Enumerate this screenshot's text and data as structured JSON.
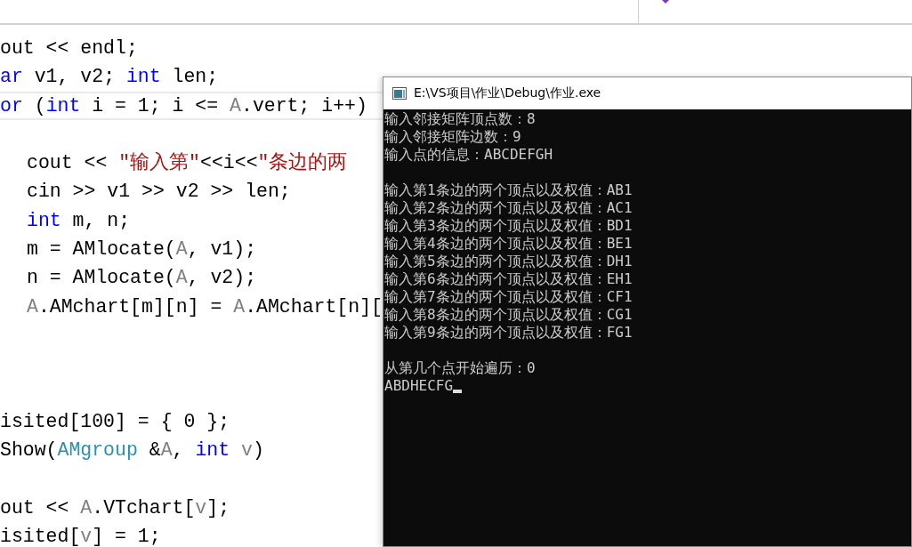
{
  "editor": {
    "lines": [
      {
        "kind": "code",
        "indented": false,
        "current": false,
        "segments": [
          {
            "kind": "plain",
            "text": "out << endl;"
          }
        ]
      },
      {
        "kind": "code",
        "indented": false,
        "current": false,
        "segments": [
          {
            "kind": "keyword",
            "text": "ar"
          },
          {
            "kind": "plain",
            "text": " v1, v2; "
          },
          {
            "kind": "keyword",
            "text": "int"
          },
          {
            "kind": "plain",
            "text": " len;"
          }
        ]
      },
      {
        "kind": "code",
        "indented": false,
        "current": true,
        "segments": [
          {
            "kind": "keyword",
            "text": "or"
          },
          {
            "kind": "plain",
            "text": " ("
          },
          {
            "kind": "keyword",
            "text": "int"
          },
          {
            "kind": "plain",
            "text": " i = 1; i <= "
          },
          {
            "kind": "param",
            "text": "A"
          },
          {
            "kind": "plain",
            "text": ".vert; i++)"
          }
        ]
      },
      {
        "kind": "blank"
      },
      {
        "kind": "code",
        "indented": true,
        "current": false,
        "segments": [
          {
            "kind": "plain",
            "text": "cout << "
          },
          {
            "kind": "string",
            "text": "\"输入第\""
          },
          {
            "kind": "plain",
            "text": "<<i<<"
          },
          {
            "kind": "string",
            "text": "\"条边的两"
          }
        ]
      },
      {
        "kind": "code",
        "indented": true,
        "current": false,
        "segments": [
          {
            "kind": "plain",
            "text": "cin >> v1 >> v2 >> len;"
          }
        ]
      },
      {
        "kind": "code",
        "indented": true,
        "current": false,
        "segments": [
          {
            "kind": "keyword",
            "text": "int"
          },
          {
            "kind": "plain",
            "text": " m, n;"
          }
        ]
      },
      {
        "kind": "code",
        "indented": true,
        "current": false,
        "segments": [
          {
            "kind": "plain",
            "text": "m = AMlocate("
          },
          {
            "kind": "param",
            "text": "A"
          },
          {
            "kind": "plain",
            "text": ", v1);"
          }
        ]
      },
      {
        "kind": "code",
        "indented": true,
        "current": false,
        "segments": [
          {
            "kind": "plain",
            "text": "n = AMlocate("
          },
          {
            "kind": "param",
            "text": "A"
          },
          {
            "kind": "plain",
            "text": ", v2);"
          }
        ]
      },
      {
        "kind": "code",
        "indented": true,
        "current": false,
        "segments": [
          {
            "kind": "param",
            "text": "A"
          },
          {
            "kind": "plain",
            "text": ".AMchart[m][n] = "
          },
          {
            "kind": "param",
            "text": "A"
          },
          {
            "kind": "plain",
            "text": ".AMchart[n]["
          }
        ]
      },
      {
        "kind": "blank"
      },
      {
        "kind": "blank"
      },
      {
        "kind": "blank"
      },
      {
        "kind": "code",
        "indented": false,
        "current": false,
        "segments": [
          {
            "kind": "plain",
            "text": "isited[100] = { 0 };"
          }
        ]
      },
      {
        "kind": "code",
        "indented": false,
        "current": false,
        "segments": [
          {
            "kind": "plain",
            "text": "Show("
          },
          {
            "kind": "type",
            "text": "AMgroup"
          },
          {
            "kind": "plain",
            "text": " &"
          },
          {
            "kind": "param",
            "text": "A"
          },
          {
            "kind": "plain",
            "text": ", "
          },
          {
            "kind": "keyword",
            "text": "int"
          },
          {
            "kind": "param",
            "text": " v"
          },
          {
            "kind": "plain",
            "text": ")"
          }
        ]
      },
      {
        "kind": "blank"
      },
      {
        "kind": "code",
        "indented": false,
        "current": false,
        "segments": [
          {
            "kind": "plain",
            "text": "out << "
          },
          {
            "kind": "param",
            "text": "A"
          },
          {
            "kind": "plain",
            "text": ".VTchart["
          },
          {
            "kind": "param",
            "text": "v"
          },
          {
            "kind": "plain",
            "text": "];"
          }
        ]
      },
      {
        "kind": "code",
        "indented": false,
        "current": false,
        "segments": [
          {
            "kind": "plain",
            "text": "isited["
          },
          {
            "kind": "param",
            "text": "v"
          },
          {
            "kind": "plain",
            "text": "] = 1;"
          }
        ]
      }
    ]
  },
  "console": {
    "title": "E:\\VS项目\\作业\\Debug\\作业.exe",
    "cursor_visible": true,
    "lines": [
      {
        "kind": "text",
        "text": "输入邻接矩阵顶点数：8"
      },
      {
        "kind": "text",
        "text": "输入邻接矩阵边数：9"
      },
      {
        "kind": "text",
        "text": "输入点的信息：ABCDEFGH"
      },
      {
        "kind": "blank"
      },
      {
        "kind": "text",
        "text": "输入第1条边的两个顶点以及权值：AB1"
      },
      {
        "kind": "text",
        "text": "输入第2条边的两个顶点以及权值：AC1"
      },
      {
        "kind": "text",
        "text": "输入第3条边的两个顶点以及权值：BD1"
      },
      {
        "kind": "text",
        "text": "输入第4条边的两个顶点以及权值：BE1"
      },
      {
        "kind": "text",
        "text": "输入第5条边的两个顶点以及权值：DH1"
      },
      {
        "kind": "text",
        "text": "输入第6条边的两个顶点以及权值：EH1"
      },
      {
        "kind": "text",
        "text": "输入第7条边的两个顶点以及权值：CF1"
      },
      {
        "kind": "text",
        "text": "输入第8条边的两个顶点以及权值：CG1"
      },
      {
        "kind": "text",
        "text": "输入第9条边的两个顶点以及权值：FG1"
      },
      {
        "kind": "blank"
      },
      {
        "kind": "text",
        "text": "从第几个点开始遍历：0"
      },
      {
        "kind": "text",
        "text": "ABDHECFG"
      }
    ]
  }
}
